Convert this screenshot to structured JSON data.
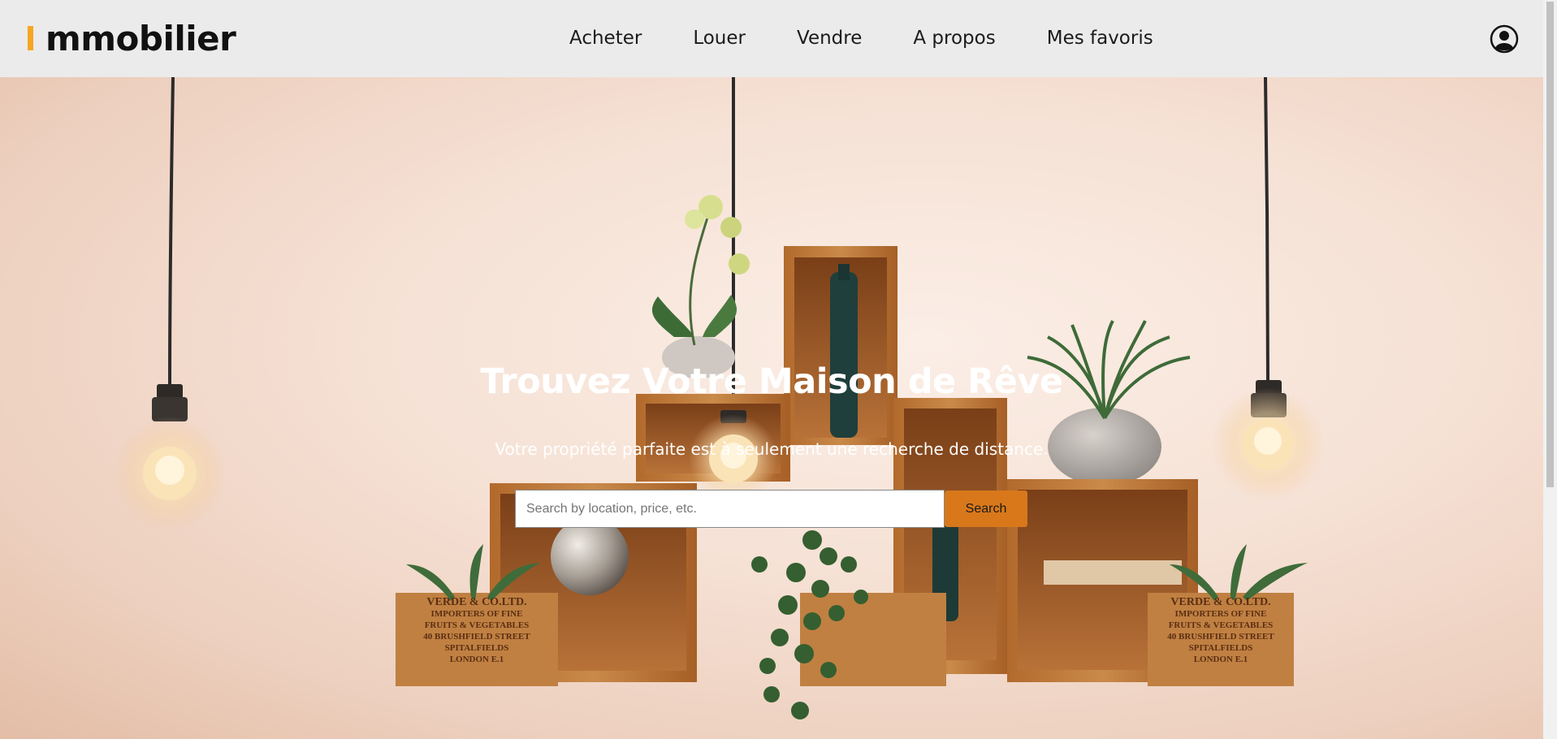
{
  "brand": {
    "logo_text": "mmobilier",
    "accent_color": "#f5a623"
  },
  "nav": {
    "links": [
      {
        "label": "Acheter"
      },
      {
        "label": "Louer"
      },
      {
        "label": "Vendre"
      },
      {
        "label": "A propos"
      },
      {
        "label": "Mes favoris"
      }
    ],
    "user_icon": "user-circle-icon"
  },
  "hero": {
    "title": "Trouvez Votre Maison de Rêve",
    "subtitle": "Votre propriété parfaite est à seulement une recherche de distance.",
    "search": {
      "placeholder": "Search by location, price, etc.",
      "value": "",
      "button_label": "Search",
      "button_color": "#d8781a"
    }
  },
  "crate_labels": {
    "left": [
      "VERDE & CO.LTD.",
      "IMPORTERS OF FINE",
      "FRUITS & VEGETABLES",
      "40 BRUSHFIELD STREET",
      "SPITALFIELDS",
      "LONDON E.1"
    ],
    "right": [
      "VERDE & CO.LTD.",
      "IMPORTERS OF FINE",
      "FRUITS & VEGETABLES",
      "40 BRUSHFIELD STREET",
      "SPITALFIELDS",
      "LONDON E.1"
    ]
  }
}
